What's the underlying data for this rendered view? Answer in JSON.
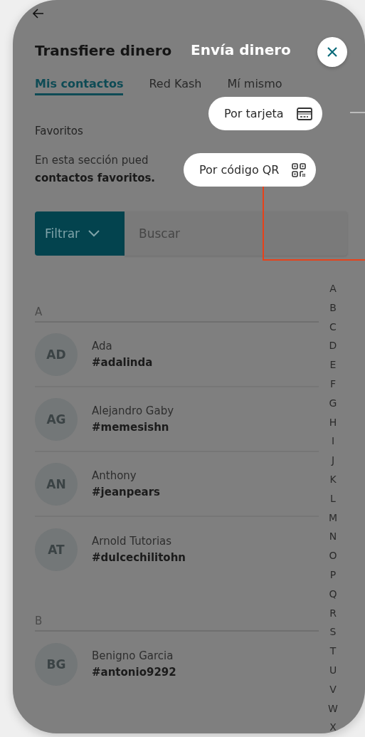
{
  "header": {
    "title": "Transfiere dinero"
  },
  "tabs": [
    {
      "label": "Mis contactos",
      "selected": true
    },
    {
      "label": "Red Kash",
      "selected": false
    },
    {
      "label": "Mí mismo",
      "selected": false
    }
  ],
  "favorites": {
    "heading": "Favoritos",
    "description": "En esta sección pued\n**contactos favoritos.**"
  },
  "filter": {
    "label": "Filtrar",
    "placeholder": "Buscar"
  },
  "sections": [
    {
      "letter": "A",
      "contacts": [
        {
          "initials": "AD",
          "name": "Ada",
          "handle": "#adalinda"
        },
        {
          "initials": "AG",
          "name": "Alejandro Gaby",
          "handle": "#memesishn"
        },
        {
          "initials": "AN",
          "name": "Anthony",
          "handle": "#jeanpears"
        },
        {
          "initials": "AT",
          "name": "Arnold Tutorias",
          "handle": "#dulcechilitohn"
        }
      ]
    },
    {
      "letter": "B",
      "contacts": [
        {
          "initials": "BG",
          "name": "Benigno Garcia",
          "handle": "#antonio9292"
        }
      ]
    }
  ],
  "alphabet_index": [
    "A",
    "B",
    "C",
    "D",
    "E",
    "F",
    "G",
    "H",
    "I",
    "J",
    "K",
    "L",
    "M",
    "N",
    "O",
    "P",
    "Q",
    "R",
    "S",
    "T",
    "U",
    "V",
    "W",
    "X"
  ],
  "send_menu": {
    "title": "Envía dinero",
    "options": [
      {
        "label": "Por tarjeta",
        "kind": "card"
      },
      {
        "label": "Por código QR",
        "kind": "qr"
      }
    ]
  }
}
